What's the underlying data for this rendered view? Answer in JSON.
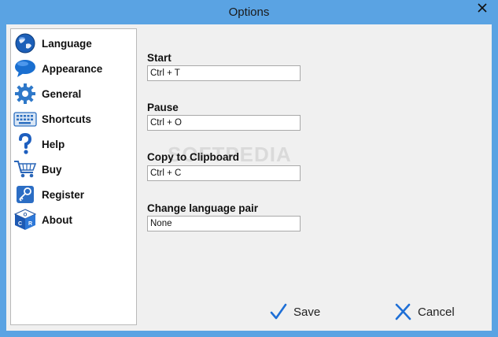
{
  "window": {
    "title": "Options"
  },
  "sidebar": {
    "items": [
      {
        "label": "Language",
        "icon": "globe-icon"
      },
      {
        "label": "Appearance",
        "icon": "speech-bubble-icon"
      },
      {
        "label": "General",
        "icon": "gear-icon"
      },
      {
        "label": "Shortcuts",
        "icon": "keyboard-icon"
      },
      {
        "label": "Help",
        "icon": "question-mark-icon"
      },
      {
        "label": "Buy",
        "icon": "shopping-cart-icon"
      },
      {
        "label": "Register",
        "icon": "key-icon"
      },
      {
        "label": "About",
        "icon": "ocr-cube-icon"
      }
    ]
  },
  "shortcuts": {
    "start": {
      "label": "Start",
      "value": "Ctrl + T"
    },
    "pause": {
      "label": "Pause",
      "value": "Ctrl + O"
    },
    "copy": {
      "label": "Copy to Clipboard",
      "value": "Ctrl + C"
    },
    "language_pair": {
      "label": "Change language pair",
      "value": "None"
    }
  },
  "buttons": {
    "save": "Save",
    "cancel": "Cancel"
  },
  "watermark": "SOFTPEDIA",
  "colors": {
    "titlebar": "#5aa3e3",
    "client": "#f0f0f0",
    "check": "#1e6fd6"
  }
}
